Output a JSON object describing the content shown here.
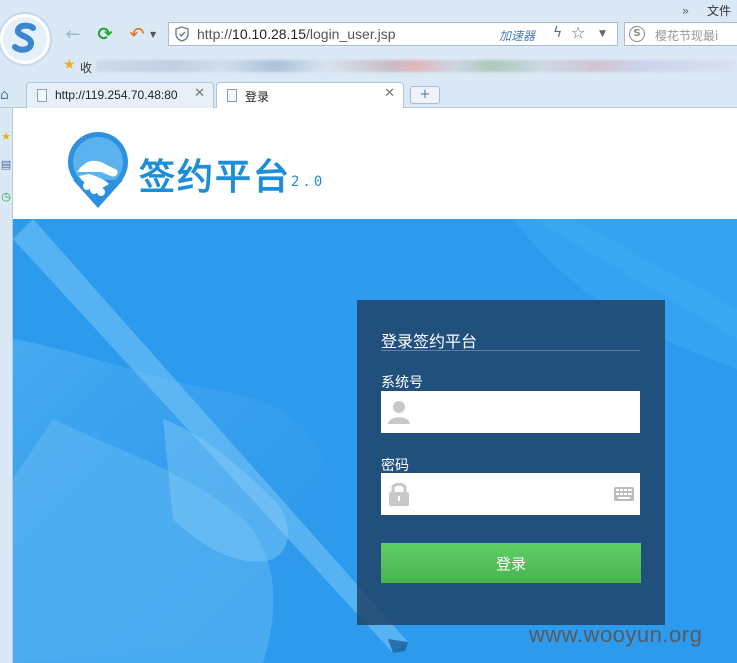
{
  "browser": {
    "top_right": {
      "chevrons": "»",
      "file_menu": "文件"
    },
    "address": {
      "url_prefix": "http://",
      "url_host": "10.10.28.15",
      "url_path": "/login_user.jsp",
      "accelerator": "加速器"
    },
    "search": {
      "placeholder": "樱花节现最i"
    },
    "bookmarks": {
      "label": "收"
    },
    "tabs": [
      {
        "label": "http://119.254.70.48:80",
        "close": "✕"
      },
      {
        "label": "登录",
        "close": "✕"
      }
    ],
    "new_tab": "+"
  },
  "page": {
    "logo_title": "签约平台",
    "logo_version": "2.0",
    "login": {
      "title": "登录签约平台",
      "system_label": "系统号",
      "system_value": "",
      "password_label": "密码",
      "password_value": "",
      "submit": "登录"
    }
  },
  "watermark": "www.wooyun.org",
  "colors": {
    "brand_blue": "#1d8fd9",
    "hero_blue": "#2f9ff0",
    "panel": "#1f4064",
    "button_green": "#52bd5a"
  },
  "icons": [
    "browser-logo-icon",
    "back-arrow-icon",
    "refresh-icon",
    "undo-icon",
    "shield-icon",
    "lightning-icon",
    "star-icon",
    "search-engine-icon",
    "home-icon",
    "page-icon",
    "user-icon",
    "lock-icon",
    "keyboard-icon",
    "handshake-logo-icon"
  ]
}
